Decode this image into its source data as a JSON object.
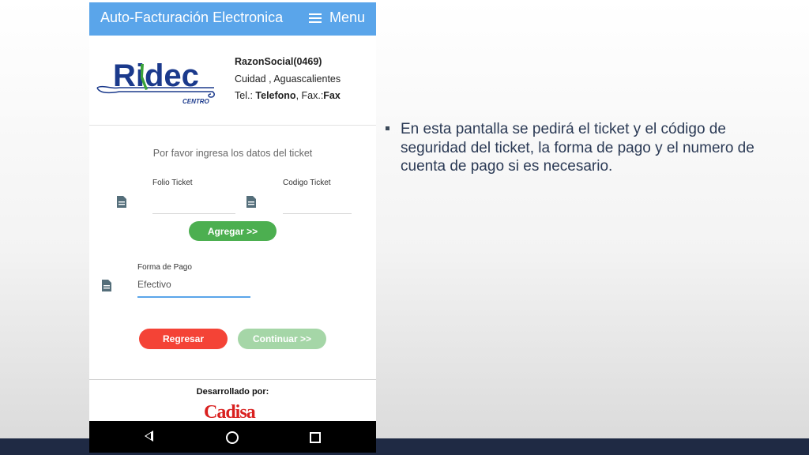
{
  "app": {
    "title": "Auto-Facturación Electronica",
    "menu_label": "Menu"
  },
  "company": {
    "logo_text": "Ridec",
    "logo_subtext": "CENTRO",
    "name": "RazonSocial(0469)",
    "city": "Cuidad , Aguascalientes",
    "tel_label": "Tel.: ",
    "tel_value": "Telefono",
    "fax_label": ", Fax.:",
    "fax_value": "Fax"
  },
  "form": {
    "prompt": "Por favor ingresa los datos del ticket",
    "folio_label": "Folio Ticket",
    "codigo_label": "Codigo Ticket",
    "agregar_label": "Agregar >>",
    "forma_pago_label": "Forma de Pago",
    "forma_pago_value": "Efectivo",
    "regresar_label": "Regresar",
    "continuar_label": "Continuar >>"
  },
  "footer": {
    "developed_by": "Desarrollado por:",
    "brand": "Cadisa"
  },
  "slide": {
    "bullet": "En esta pantalla se pedirá el ticket y el código de seguridad del ticket, la forma de pago y el numero de cuenta de pago si es necesario."
  },
  "colors": {
    "appbar": "#5aa5ea",
    "agregar": "#4caf50",
    "regresar": "#f44336",
    "continuar_disabled": "#a5d6a7",
    "brand_red": "#d9201f",
    "logo_blue": "#1b3a8c",
    "logo_green": "#3aa23a"
  },
  "icons": {
    "folio": "document-icon",
    "codigo": "document-icon",
    "forma_pago": "document-icon"
  }
}
